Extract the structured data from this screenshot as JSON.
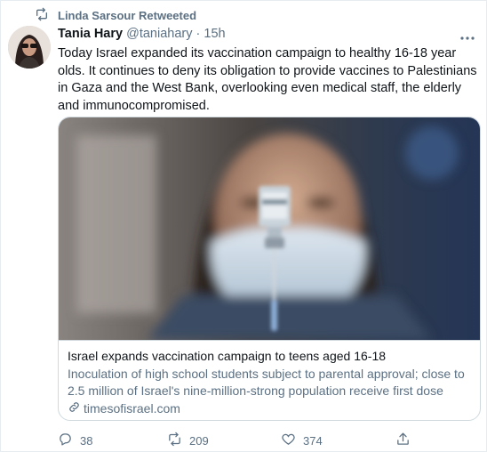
{
  "retweet": {
    "label": "Linda Sarsour Retweeted"
  },
  "tweet": {
    "name": "Tania Hary",
    "handle": "@taniahary",
    "separator": "·",
    "time": "15h",
    "text": "Today Israel expanded its vaccination campaign to healthy 16-18 year olds. It continues to deny its obligation to provide vaccines to Palestinians in Gaza and the West Bank, overlooking even medical staff, the elderly and immunocompromised."
  },
  "card": {
    "title": "Israel expands vaccination campaign to teens aged 16-18",
    "description": "Inoculation of high school students subject to parental approval; close to 2.5 million of Israel's nine-million-strong population receive first dose",
    "domain": "timesofisrael.com"
  },
  "actions": {
    "replies": "38",
    "retweets": "209",
    "likes": "374"
  },
  "icons": {
    "retweet": "retweet-icon",
    "more": "more-icon",
    "reply": "reply-icon",
    "like": "heart-icon",
    "share": "share-icon",
    "link": "link-icon"
  },
  "colors": {
    "secondary_text": "#5b7083",
    "border": "#cfd9de"
  }
}
